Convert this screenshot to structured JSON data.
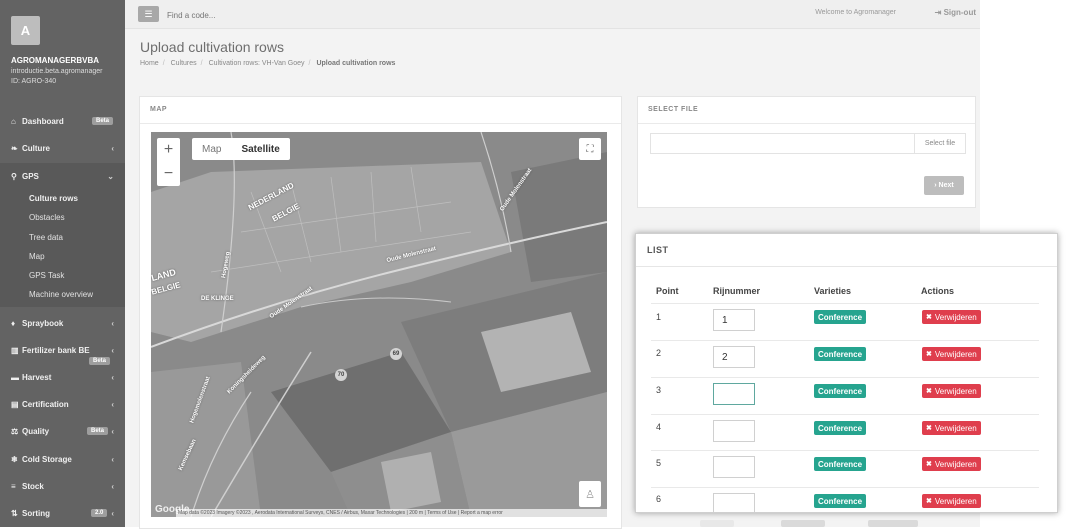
{
  "sidebar": {
    "avatar_letter": "A",
    "company": "AGROMANAGERBVBA",
    "domain": "introductie.beta.agromanager",
    "id_line": "ID: AGRO-340",
    "items": [
      {
        "label": "Dashboard",
        "icon": "home-icon",
        "badge": "Beta"
      },
      {
        "label": "Culture",
        "icon": "leaf-icon"
      },
      {
        "label": "GPS",
        "icon": "map-marker-icon"
      },
      {
        "label": "Spraybook",
        "icon": "drop-icon"
      },
      {
        "label": "Fertilizer bank BE",
        "icon": "bank-icon",
        "badge": "Beta"
      },
      {
        "label": "Harvest",
        "icon": "truck-icon"
      },
      {
        "label": "Certification",
        "icon": "book-icon"
      },
      {
        "label": "Quality",
        "icon": "scale-icon",
        "badge": "Beta"
      },
      {
        "label": "Cold Storage",
        "icon": "snowflake-icon"
      },
      {
        "label": "Stock",
        "icon": "list-icon"
      },
      {
        "label": "Sorting",
        "icon": "sort-icon",
        "badge": "2.0"
      }
    ],
    "gps_sub": [
      {
        "label": "Culture rows"
      },
      {
        "label": "Obstacles"
      },
      {
        "label": "Tree data"
      },
      {
        "label": "Map"
      },
      {
        "label": "GPS Task"
      },
      {
        "label": "Machine overview"
      }
    ]
  },
  "topbar": {
    "search_placeholder": "Find a code...",
    "welcome": "Welcome to Agromanager",
    "signout": "Sign-out"
  },
  "page": {
    "title": "Upload cultivation rows",
    "breadcrumb": [
      "Home",
      "Cultures",
      "Cultivation rows: VH-Van Goey",
      "Upload cultivation rows"
    ]
  },
  "map_panel": {
    "title": "MAP",
    "zoom_in": "+",
    "zoom_out": "−",
    "type_map": "Map",
    "type_satellite": "Satellite",
    "google": "Google",
    "attribution": "Map data ©2023 Imagery ©2023 , Aerodata International Surveys, CNES / Airbus, Maxar Technologies | 200 m | Terms of Use | Report a map error",
    "labels": {
      "nederland": "NEDERLAND",
      "belgie": "BELGIE",
      "land": "LAND",
      "belgie2": "BELGIE",
      "de_klinge": "DE KLINGE",
      "oude_molenstraat1": "Oude Molenstraat",
      "oude_molenstraat2": "Oude Molenstraat",
      "oude_molenstraat3": "Oude Molenstraat",
      "hogeweg": "Hogeweg",
      "kamperheideweg": "Koningsheideweg",
      "hogeweg2": "Hogemolenstraat",
      "kemsebaan": "Kemsebaan",
      "num69": "69",
      "num70": "70"
    }
  },
  "file_panel": {
    "title": "SELECT FILE",
    "select_file": "Select file",
    "next": "Next"
  },
  "list_panel": {
    "title": "LIST",
    "headers": {
      "point": "Point",
      "rij": "Rijnummer",
      "varieties": "Varieties",
      "actions": "Actions"
    },
    "rows": [
      {
        "point": "1",
        "rij": "1",
        "variety": "Conference",
        "action": "Verwijderen"
      },
      {
        "point": "2",
        "rij": "2",
        "variety": "Conference",
        "action": "Verwijderen"
      },
      {
        "point": "3",
        "rij": "",
        "variety": "Conference",
        "action": "Verwijderen"
      },
      {
        "point": "4",
        "rij": "",
        "variety": "Conference",
        "action": "Verwijderen"
      },
      {
        "point": "5",
        "rij": "",
        "variety": "Conference",
        "action": "Verwijderen"
      },
      {
        "point": "6",
        "rij": "",
        "variety": "Conference",
        "action": "Verwijderen"
      }
    ]
  }
}
